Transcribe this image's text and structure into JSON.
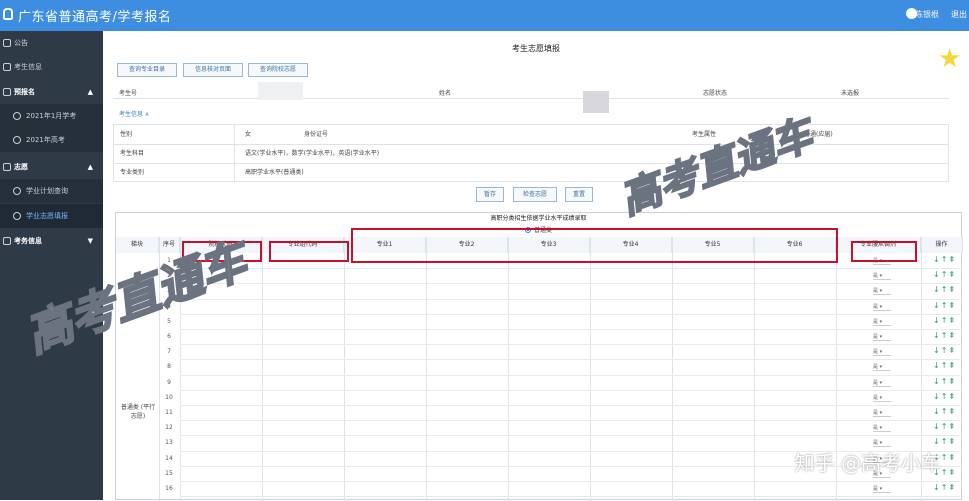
{
  "app": {
    "title": "广东省普通高考/学考报名",
    "user": "陈银根",
    "exit": "退出"
  },
  "sidebar": {
    "items": [
      {
        "label": "公告",
        "type": "top"
      },
      {
        "label": "考生信息",
        "type": "top"
      },
      {
        "label": "预报名",
        "type": "group"
      },
      {
        "label": "2021年1月学考",
        "type": "sub"
      },
      {
        "label": "2021年高考",
        "type": "sub"
      },
      {
        "label": "志愿",
        "type": "group"
      },
      {
        "label": "学业计划查询",
        "type": "sub"
      },
      {
        "label": "学业志愿填报",
        "type": "sub-active"
      },
      {
        "label": "考务信息",
        "type": "top"
      }
    ]
  },
  "main": {
    "form_title": "考生志愿填报",
    "toolbar": [
      "查询专业目录",
      "信息核对页面",
      "查询院校志愿"
    ],
    "top_info": {
      "exam_no_label": "考生号",
      "name_label": "姓名",
      "status_label": "志愿状态",
      "status_value": "未选报"
    },
    "section_label": "考生信息 ∧",
    "detail": {
      "gender_label": "性别",
      "gender_value": "女",
      "id_label": "身份证号",
      "attr_label": "考生属性",
      "attr_value": "普通(应届)",
      "subjects_label": "考生科目",
      "subjects_value": "语文(学业水平)，数学(学业水平)，英语(学业水平)",
      "category_label": "专业类别",
      "category_value": "高职学业水平(普通类)"
    },
    "actions": [
      "暂存",
      "检查志愿",
      "重置"
    ],
    "grid": {
      "title": "高职分类招生依据学业水平成绩录取",
      "radio_label": "普通类",
      "headers": [
        "梯块",
        "序号",
        "院校代码",
        "专业组代码",
        "专业1",
        "专业2",
        "专业3",
        "专业4",
        "专业5",
        "专业6",
        "专业服从调剂",
        "操作"
      ],
      "batch_label": "普通类 (平行志愿)",
      "rows": [
        "1",
        "2",
        "3",
        "4",
        "5",
        "6",
        "7",
        "8",
        "9",
        "10",
        "11",
        "12",
        "13",
        "14",
        "15",
        "16"
      ],
      "select_value": "是"
    }
  },
  "watermarks": [
    "高考直通车",
    "高考直通车",
    "知乎 @高考小车"
  ]
}
